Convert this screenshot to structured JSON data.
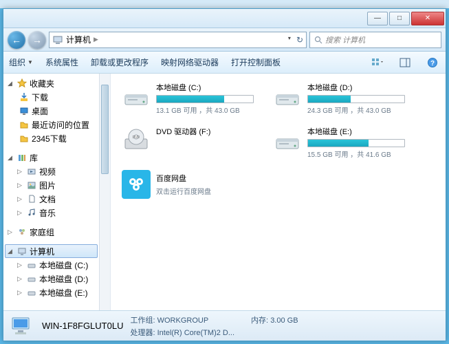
{
  "window": {
    "minimize": "—",
    "maximize": "□",
    "close": "✕"
  },
  "nav": {
    "back": "←",
    "forward": "→",
    "location": "计算机",
    "arrow": "▶",
    "dropdown": "▾",
    "refresh": "↻"
  },
  "search": {
    "placeholder": "搜索 计算机"
  },
  "toolbar": {
    "organize": "组织",
    "properties": "系统属性",
    "uninstall": "卸载或更改程序",
    "mapdrive": "映射网络驱动器",
    "controlpanel": "打开控制面板"
  },
  "sidebar": {
    "favorites": {
      "label": "收藏夹",
      "items": [
        "下载",
        "桌面",
        "最近访问的位置",
        "2345下载"
      ]
    },
    "libraries": {
      "label": "库",
      "items": [
        "视频",
        "图片",
        "文档",
        "音乐"
      ]
    },
    "homegroup": "家庭组",
    "computer": {
      "label": "计算机",
      "items": [
        "本地磁盘 (C:)",
        "本地磁盘 (D:)",
        "本地磁盘 (E:)"
      ]
    }
  },
  "drives": [
    {
      "name": "本地磁盘 (C:)",
      "free": "13.1 GB",
      "total": "43.0 GB",
      "pct": 70
    },
    {
      "name": "本地磁盘 (D:)",
      "free": "24.3 GB",
      "total": "43.0 GB",
      "pct": 44
    },
    {
      "name": "本地磁盘 (E:)",
      "free": "15.5 GB",
      "total": "41.6 GB",
      "pct": 63
    }
  ],
  "drive_stats_tpl": {
    "free_word": "可用",
    "sep": "，共"
  },
  "dvd": {
    "name": "DVD 驱动器 (F:)"
  },
  "app": {
    "name": "百度网盘",
    "desc": "双击运行百度网盘"
  },
  "status": {
    "name": "WIN-1F8FGLUT0LU",
    "workgroup_label": "工作组:",
    "workgroup": "WORKGROUP",
    "cpu_label": "处理器:",
    "cpu": "Intel(R) Core(TM)2 D...",
    "mem_label": "内存:",
    "mem": "3.00 GB"
  }
}
